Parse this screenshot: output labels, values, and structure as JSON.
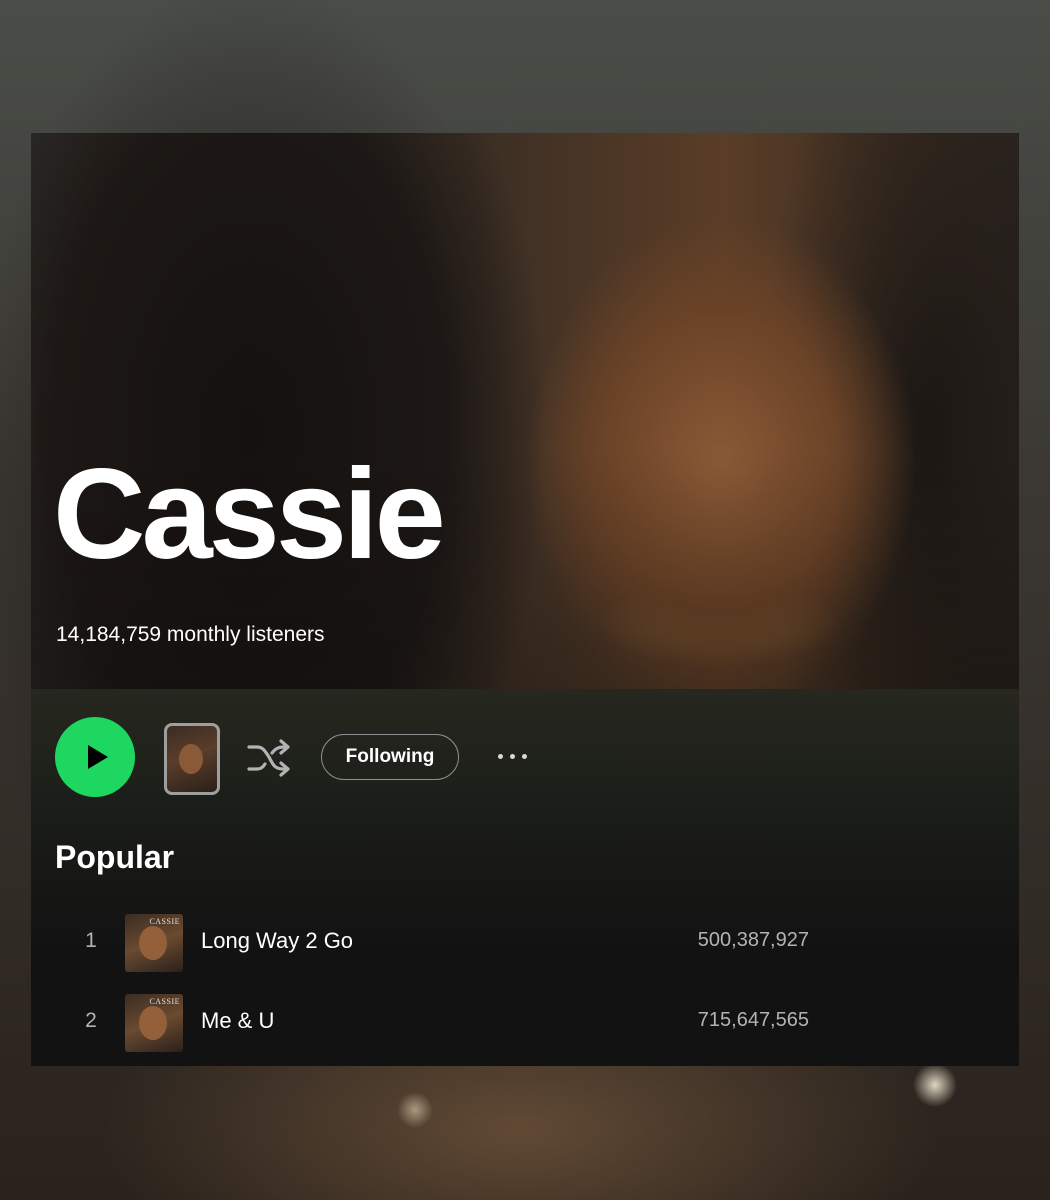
{
  "artist": {
    "name": "Cassie",
    "monthly_listeners": "14,184,759 monthly listeners"
  },
  "controls": {
    "play_icon": "play-icon",
    "shuffle_icon": "shuffle-icon",
    "following_label": "Following",
    "more_icon": "more-options-icon"
  },
  "popular": {
    "title": "Popular",
    "tracks": [
      {
        "number": "1",
        "title": "Long Way 2 Go",
        "plays": "500,387,927",
        "cover_text": "CASSIE"
      },
      {
        "number": "2",
        "title": "Me & U",
        "plays": "715,647,565",
        "cover_text": "CASSIE"
      }
    ]
  },
  "colors": {
    "accent": "#1ed760",
    "background": "#121212",
    "text_primary": "#ffffff",
    "text_secondary": "#b3b3b3"
  }
}
